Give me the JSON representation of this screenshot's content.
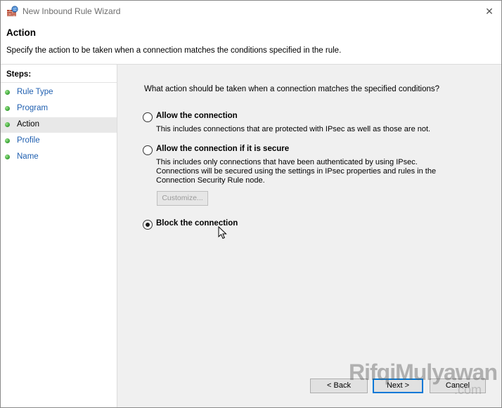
{
  "window": {
    "title": "New Inbound Rule Wizard",
    "close_glyph": "✕"
  },
  "header": {
    "title": "Action",
    "subtitle": "Specify the action to be taken when a connection matches the conditions specified in the rule."
  },
  "steps": {
    "heading": "Steps:",
    "items": [
      {
        "label": "Rule Type",
        "state": "completed"
      },
      {
        "label": "Program",
        "state": "completed"
      },
      {
        "label": "Action",
        "state": "current"
      },
      {
        "label": "Profile",
        "state": "pending"
      },
      {
        "label": "Name",
        "state": "pending"
      }
    ]
  },
  "main": {
    "question": "What action should be taken when a connection matches the specified conditions?",
    "options": [
      {
        "label": "Allow the connection",
        "description": "This includes connections that are protected with IPsec as well as those are not.",
        "selected": false
      },
      {
        "label": "Allow the connection if it is secure",
        "description": "This includes only connections that have been authenticated by using IPsec.  Connections will be secured using the settings in IPsec properties and rules in the Connection Security Rule node.",
        "selected": false
      },
      {
        "label": "Block the connection",
        "description": "",
        "selected": true
      }
    ],
    "customize_label": "Customize..."
  },
  "footer": {
    "back_label": "< Back",
    "next_label": "Next >",
    "cancel_label": "Cancel"
  },
  "watermark": {
    "text": "RifqiMulyawan",
    "suffix": ".com"
  },
  "colors": {
    "step_link": "#1f5fb0",
    "step_dot": "#3fa83a",
    "default_button_border": "#0078d7",
    "pane_background": "#f0f0f0"
  },
  "icons": {
    "app": "firewall-wizard-icon",
    "close": "close-icon",
    "step_status": "green-dot-icon",
    "pointer": "mouse-cursor-icon"
  }
}
